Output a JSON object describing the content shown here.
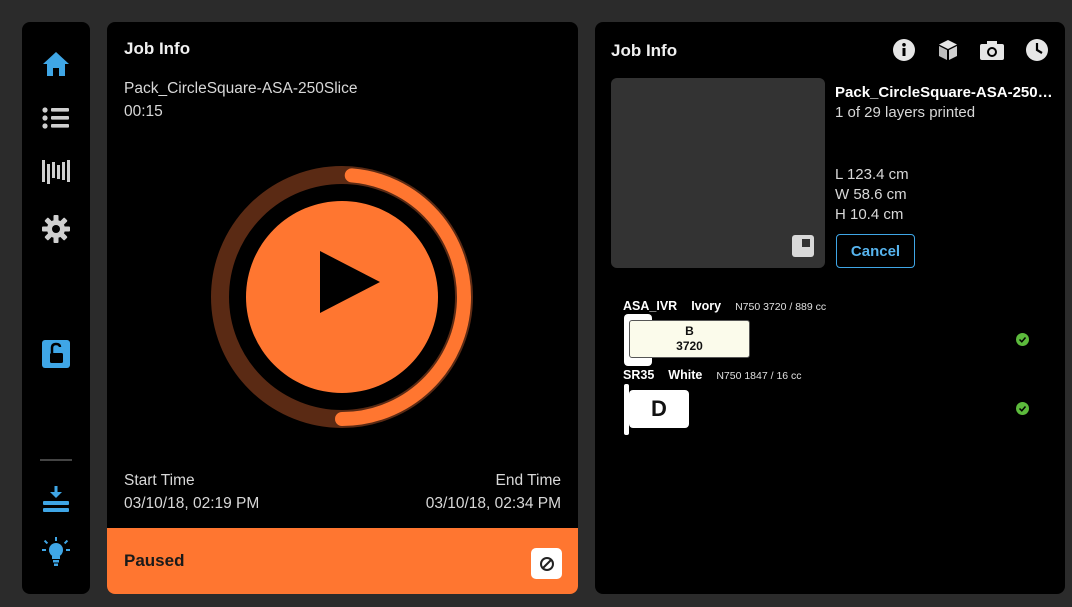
{
  "sidebar": {
    "icons": [
      "home-icon",
      "list-icon",
      "filament-icon",
      "gear-icon",
      "unlock-icon",
      "unload-icon",
      "light-bulb-icon"
    ]
  },
  "left": {
    "title": "Job Info",
    "job_name": "Pack_CircleSquare-ASA-250Slice",
    "elapsed": "00:15",
    "start_label": "Start Time",
    "start_value": "03/10/18, 02:19 PM",
    "end_label": "End Time",
    "end_value": "03/10/18, 02:34 PM",
    "status": "Paused",
    "progress_fraction": 0.5
  },
  "right": {
    "title": "Job Info",
    "header_icons": [
      "info-icon",
      "cube-icon",
      "camera-icon",
      "clock-icon"
    ],
    "job_name": "Pack_CircleSquare-ASA-250…",
    "layers": "1 of 29 layers printed",
    "length": "L 123.4 cm",
    "width": "W 58.6 cm",
    "height": "H 10.4 cm",
    "cancel_label": "Cancel",
    "materials": [
      {
        "material": "ASA_IVR",
        "color": "Ivory",
        "detail": "N750 3720 / 889 cc",
        "slot": "B",
        "code": "3720"
      },
      {
        "material": "SR35",
        "color": "White",
        "detail": "N750 1847 / 16 cc",
        "slot": "D",
        "code": ""
      }
    ]
  },
  "colors": {
    "accent": "#ff7630",
    "accent_dark": "#5a2a14",
    "blue": "#3fa6e6"
  }
}
